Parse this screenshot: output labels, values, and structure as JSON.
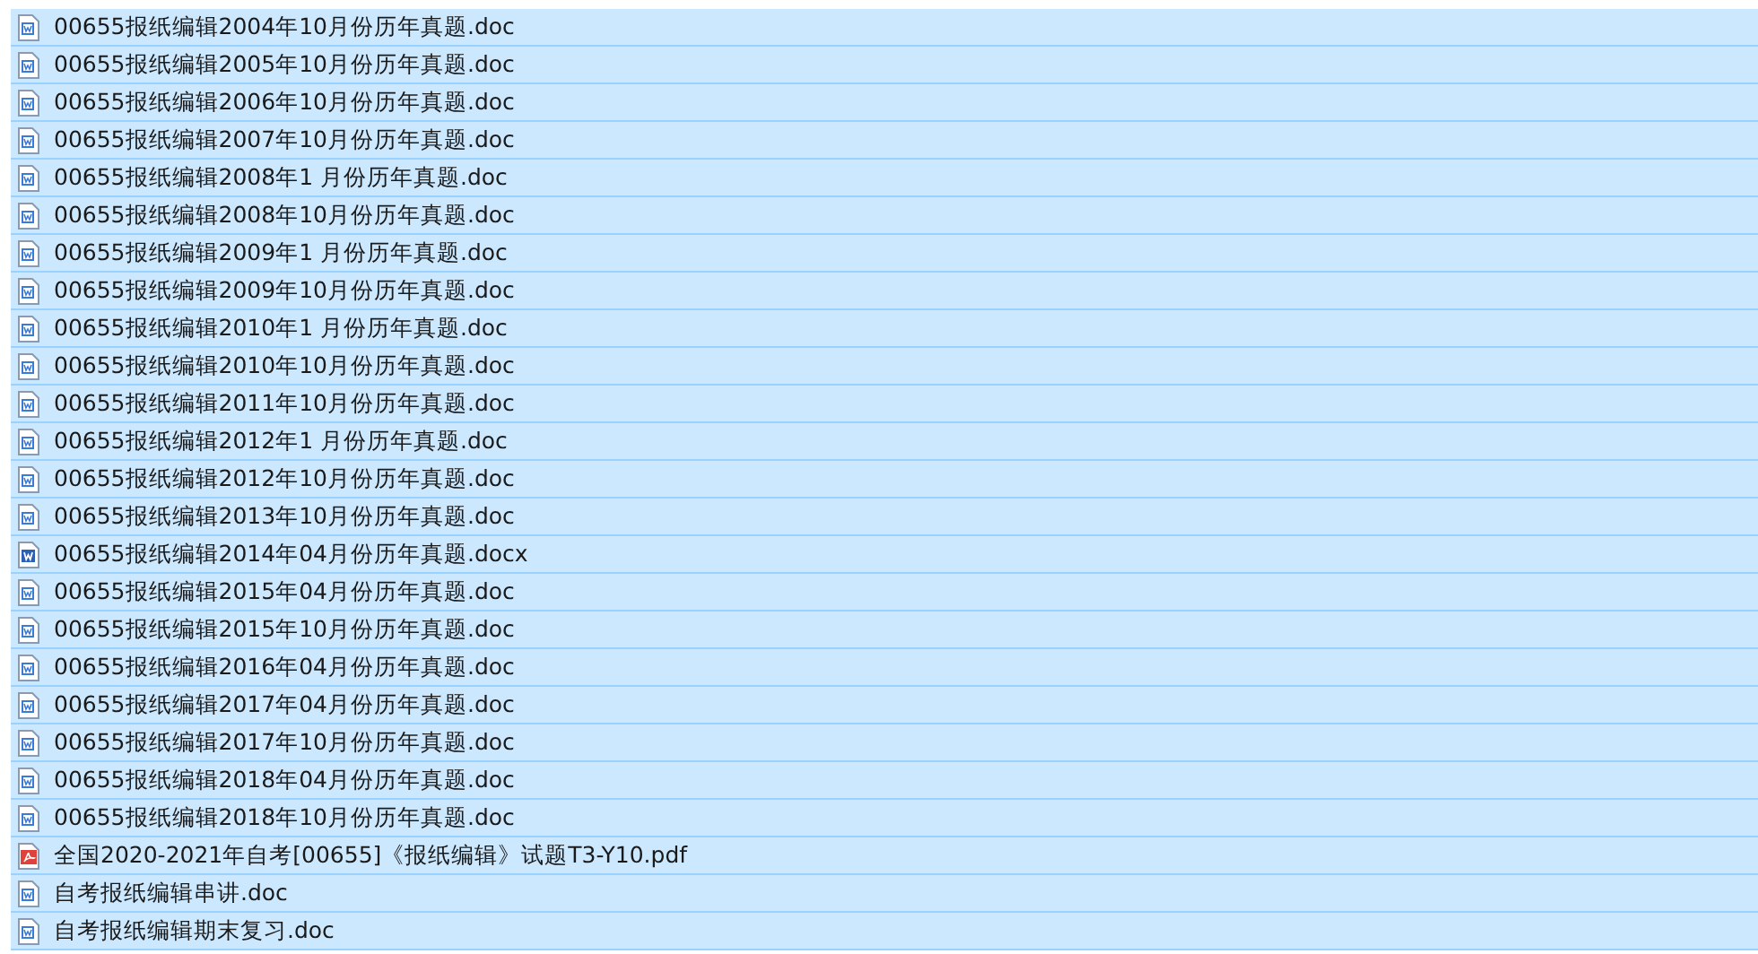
{
  "files": [
    {
      "name": "00655报纸编辑2004年10月份历年真题.doc",
      "kind": "doc",
      "selected": true
    },
    {
      "name": "00655报纸编辑2005年10月份历年真题.doc",
      "kind": "doc",
      "selected": true
    },
    {
      "name": "00655报纸编辑2006年10月份历年真题.doc",
      "kind": "doc",
      "selected": true
    },
    {
      "name": "00655报纸编辑2007年10月份历年真题.doc",
      "kind": "doc",
      "selected": true
    },
    {
      "name": "00655报纸编辑2008年1 月份历年真题.doc",
      "kind": "doc",
      "selected": true
    },
    {
      "name": "00655报纸编辑2008年10月份历年真题.doc",
      "kind": "doc",
      "selected": true
    },
    {
      "name": "00655报纸编辑2009年1 月份历年真题.doc",
      "kind": "doc",
      "selected": true
    },
    {
      "name": "00655报纸编辑2009年10月份历年真题.doc",
      "kind": "doc",
      "selected": true
    },
    {
      "name": "00655报纸编辑2010年1 月份历年真题.doc",
      "kind": "doc",
      "selected": true
    },
    {
      "name": "00655报纸编辑2010年10月份历年真题.doc",
      "kind": "doc",
      "selected": true
    },
    {
      "name": "00655报纸编辑2011年10月份历年真题.doc",
      "kind": "doc",
      "selected": true
    },
    {
      "name": "00655报纸编辑2012年1 月份历年真题.doc",
      "kind": "doc",
      "selected": true
    },
    {
      "name": "00655报纸编辑2012年10月份历年真题.doc",
      "kind": "doc",
      "selected": true
    },
    {
      "name": "00655报纸编辑2013年10月份历年真题.doc",
      "kind": "doc",
      "selected": true
    },
    {
      "name": "00655报纸编辑2014年04月份历年真题.docx",
      "kind": "docx",
      "selected": true
    },
    {
      "name": "00655报纸编辑2015年04月份历年真题.doc",
      "kind": "doc",
      "selected": true
    },
    {
      "name": "00655报纸编辑2015年10月份历年真题.doc",
      "kind": "doc",
      "selected": true
    },
    {
      "name": "00655报纸编辑2016年04月份历年真题.doc",
      "kind": "doc",
      "selected": true
    },
    {
      "name": "00655报纸编辑2017年04月份历年真题.doc",
      "kind": "doc",
      "selected": true
    },
    {
      "name": "00655报纸编辑2017年10月份历年真题.doc",
      "kind": "doc",
      "selected": true
    },
    {
      "name": "00655报纸编辑2018年04月份历年真题.doc",
      "kind": "doc",
      "selected": true
    },
    {
      "name": "00655报纸编辑2018年10月份历年真题.doc",
      "kind": "doc",
      "selected": true
    },
    {
      "name": "全国2020-2021年自考[00655]《报纸编辑》试题T3-Y10.pdf",
      "kind": "pdf",
      "selected": true
    },
    {
      "name": "自考报纸编辑串讲.doc",
      "kind": "doc",
      "selected": true
    },
    {
      "name": "自考报纸编辑期末复习.doc",
      "kind": "doc",
      "selected": true
    }
  ]
}
